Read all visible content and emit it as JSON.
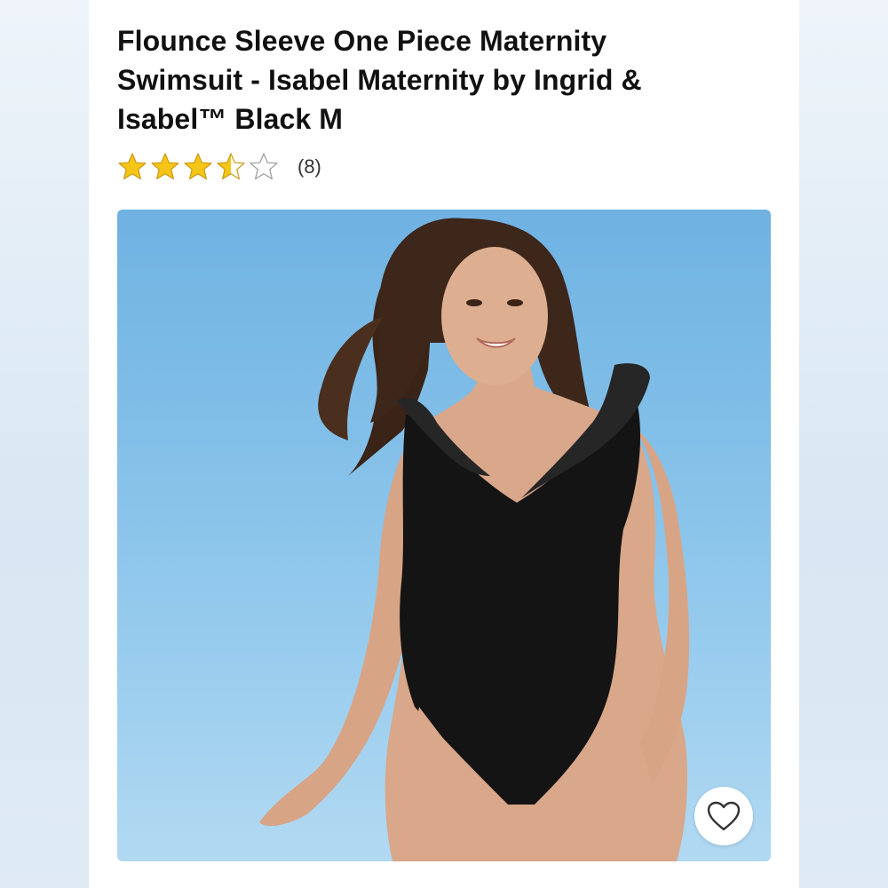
{
  "product": {
    "title": "Flounce Sleeve One Piece Maternity Swimsuit - Isabel Maternity by Ingrid & Isabel™ Black M",
    "rating": {
      "value": 3.5,
      "max": 5,
      "count_label": "(8)"
    },
    "star_color": "#f5c518"
  },
  "image": {
    "background_color": "#82bfe8",
    "favorite_icon": "heart-outline-icon"
  }
}
